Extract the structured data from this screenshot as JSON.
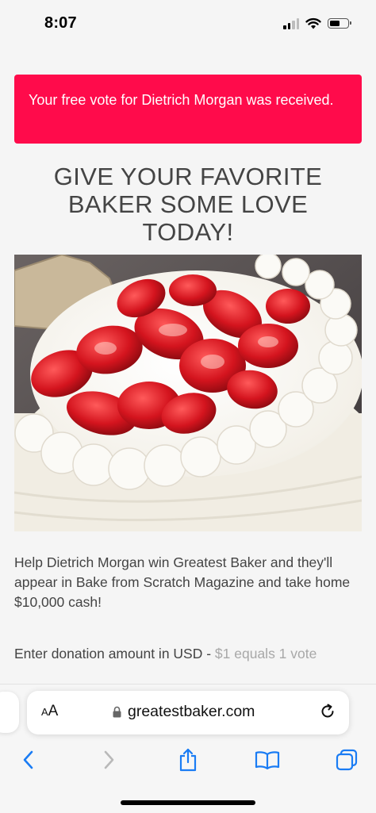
{
  "status_bar": {
    "time": "8:07"
  },
  "alert": {
    "message": "Your free vote for Dietrich Morgan was received."
  },
  "headline": "GIVE YOUR FAVORITE BAKER SOME LOVE TODAY!",
  "hero_image": {
    "subject": "strawberry-cream-cake-photo"
  },
  "description": "Help Dietrich Morgan win Greatest Baker and they'll appear in Bake from Scratch Magazine and take home $10,000 cash!",
  "donation": {
    "label": "Enter donation amount in USD - ",
    "hint": "$1 equals 1 vote"
  },
  "browser": {
    "text_size_label_small": "A",
    "text_size_label_large": "A",
    "url": "greatestbaker.com"
  },
  "colors": {
    "alert": "#ff0b4b",
    "accent": "#1a7cf4"
  }
}
